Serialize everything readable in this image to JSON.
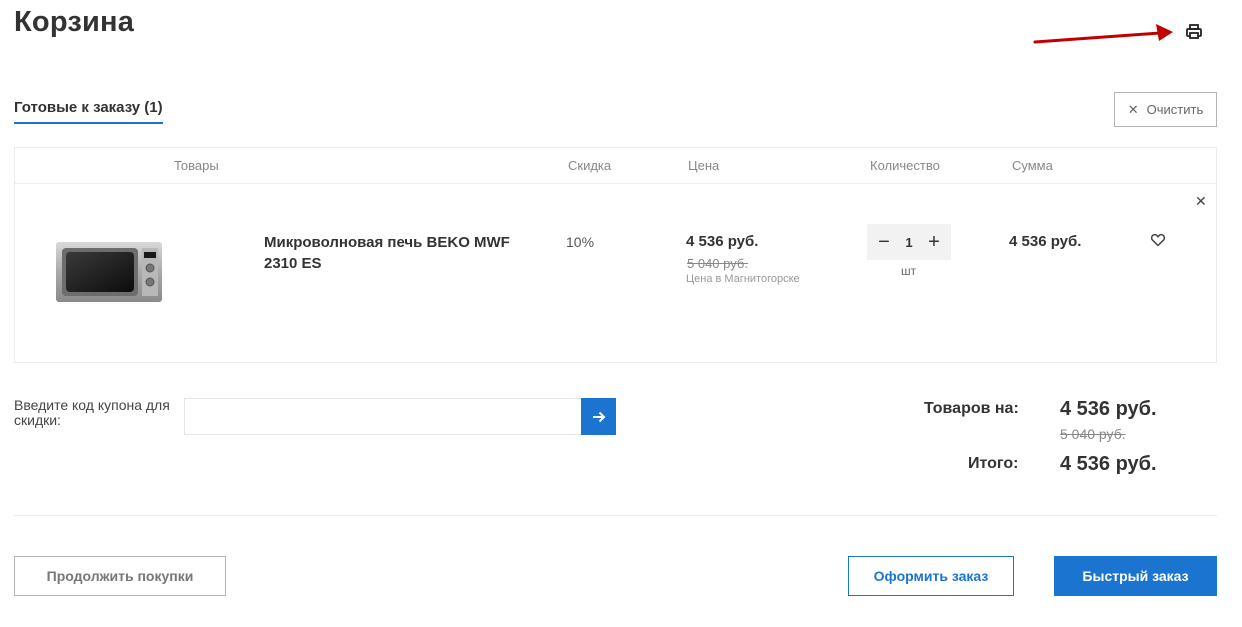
{
  "page": {
    "title": "Корзина"
  },
  "tabs": {
    "ready_label": "Готовые к заказу (1)"
  },
  "actions": {
    "clear_label": "Очистить",
    "clear_icon": "close-icon",
    "print_icon": "printer-icon"
  },
  "table": {
    "headers": [
      "Товары",
      "Скидка",
      "Цена",
      "Количество",
      "Сумма"
    ],
    "items": [
      {
        "name": "Микроволновая печь BEKO MWF 2310 ES",
        "discount": "10%",
        "price": "4 536 руб.",
        "old_price": "5 040 руб.",
        "price_note": "Цена в Магнитогорске",
        "quantity": "1",
        "unit": "шт",
        "sum": "4 536 руб."
      }
    ]
  },
  "coupon": {
    "label": "Введите код купона для скидки:",
    "value": "",
    "submit_icon": "arrow-right-icon"
  },
  "totals": {
    "goods_label": "Товаров на:",
    "goods_value": "4 536 руб.",
    "goods_old": "5 040 руб.",
    "total_label": "Итого:",
    "total_value": "4 536 руб."
  },
  "buttons": {
    "continue": "Продолжить покупки",
    "checkout": "Оформить заказ",
    "quick_order": "Быстрый заказ"
  },
  "colors": {
    "accent": "#1b75d0",
    "annotation": "#c00000"
  }
}
